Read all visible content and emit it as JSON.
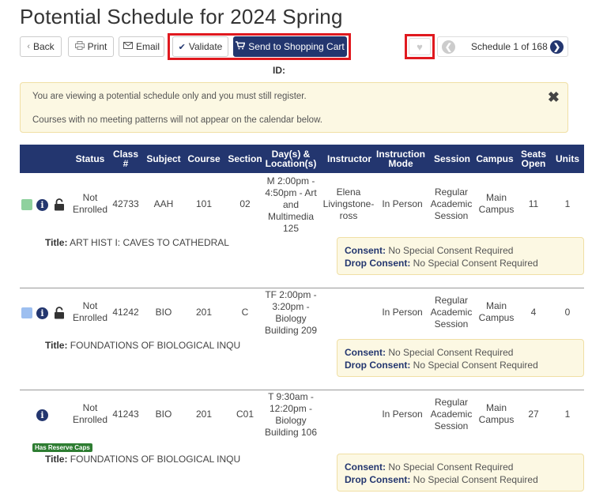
{
  "page": {
    "title": "Potential Schedule for 2024 Spring"
  },
  "toolbar": {
    "back_label": "Back",
    "print_label": "Print",
    "email_label": "Email",
    "validate_label": "Validate",
    "send_label": "Send to Shopping Cart",
    "id_label": "ID:",
    "schedule_label": "Schedule 1 of 168"
  },
  "alert": {
    "line1": "You are viewing a potential schedule only and you must still register.",
    "line2": "Courses with no meeting patterns will not appear on the calendar below."
  },
  "table": {
    "headers": {
      "status": "Status",
      "class": "Class #",
      "subject": "Subject",
      "course": "Course",
      "section": "Section",
      "days": "Day(s) & Location(s)",
      "instructor": "Instructor",
      "mode": "Instruction Mode",
      "session": "Session",
      "campus": "Campus",
      "seats": "Seats Open",
      "units": "Units"
    },
    "rows": [
      {
        "swatch_color": "#8fd19e",
        "status": "Not Enrolled",
        "class": "42733",
        "subject": "AAH",
        "course": "101",
        "section": "02",
        "days": "M 2:00pm - 4:50pm - Art and Multimedia 125",
        "instructor": "Elena Livingstone-ross",
        "mode": "In Person",
        "session": "Regular Academic Session",
        "campus": "Main Campus",
        "seats": "11",
        "units": "1",
        "title_label": "Title:",
        "title": "ART HIST I: CAVES TO CATHEDRAL",
        "consent_label": "Consent:",
        "consent": "No Special Consent Required",
        "drop_label": "Drop Consent:",
        "drop": "No Special Consent Required"
      },
      {
        "swatch_color": "#9dbff0",
        "status": "Not Enrolled",
        "class": "41242",
        "subject": "BIO",
        "course": "201",
        "section": "C",
        "days": "TF 2:00pm - 3:20pm - Biology Building 209",
        "instructor": "",
        "mode": "In Person",
        "session": "Regular Academic Session",
        "campus": "Main Campus",
        "seats": "4",
        "units": "0",
        "title_label": "Title:",
        "title": "FOUNDATIONS OF BIOLOGICAL INQU",
        "consent_label": "Consent:",
        "consent": "No Special Consent Required",
        "drop_label": "Drop Consent:",
        "drop": "No Special Consent Required"
      },
      {
        "badge": "Has Reserve Caps",
        "status": "Not Enrolled",
        "class": "41243",
        "subject": "BIO",
        "course": "201",
        "section": "C01",
        "days": "T 9:30am - 12:20pm - Biology Building 106",
        "instructor": "",
        "mode": "In Person",
        "session": "Regular Academic Session",
        "campus": "Main Campus",
        "seats": "27",
        "units": "1",
        "title_label": "Title:",
        "title": "FOUNDATIONS OF BIOLOGICAL INQU",
        "consent_label": "Consent:",
        "consent": "No Special Consent Required",
        "drop_label": "Drop Consent:",
        "drop": "No Special Consent Required"
      }
    ]
  },
  "colors": {
    "navy": "#23366f",
    "highlight_red": "#e0191f",
    "alert_bg": "#fcf8e3"
  }
}
